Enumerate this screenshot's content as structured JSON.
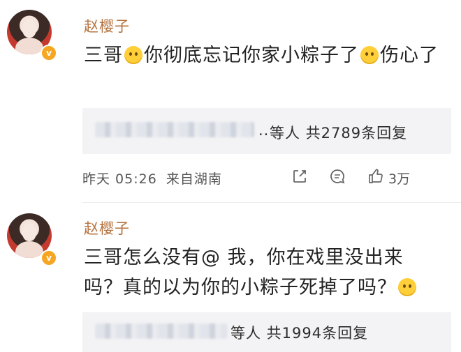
{
  "comments": [
    {
      "username": "赵樱子",
      "text_before": "三哥",
      "text_middle": "你彻底忘记你家小粽子了",
      "text_after": "伤心了",
      "emoji_1": "smile-emoji",
      "emoji_2": "sad-emoji",
      "blurred_prefix": "..",
      "reply_summary": "等人 共2789条回复",
      "time": "昨天 05:26",
      "location": "来自湖南",
      "like_count": "3万",
      "icons": [
        "share-icon",
        "comment-icon",
        "like-icon"
      ]
    },
    {
      "username": "赵樱子",
      "text_line": "三哥怎么没有@ 我，你在戏里没出来吗？真的以为你的小粽子死掉了吗？",
      "emoji_1": "crying-emoji",
      "reply_summary": "等人 共1994条回复"
    }
  ],
  "colors": {
    "username": "#b5733e",
    "badge": "#f5a623",
    "reply_bg": "#f3f3f5"
  }
}
